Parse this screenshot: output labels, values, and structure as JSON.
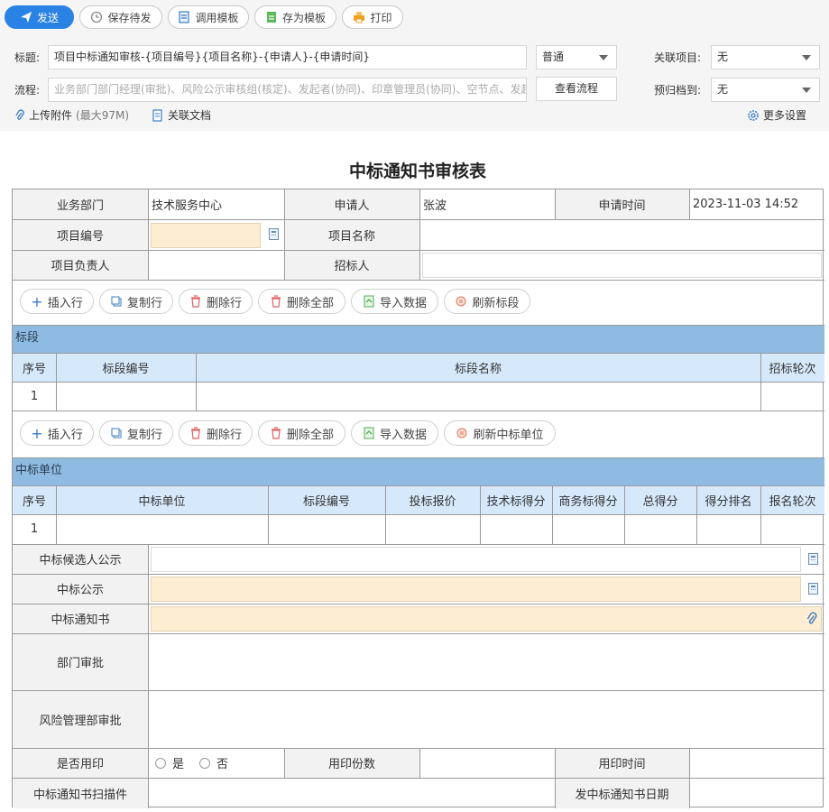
{
  "toolbar": {
    "send": "发送",
    "save_draft": "保存待发",
    "use_template": "调用模板",
    "save_template": "存为模板",
    "print": "打印"
  },
  "header": {
    "title_label": "标题:",
    "title_value": "项目中标通知审核-{项目编号}{项目名称}-{申请人}-{申请时间}",
    "priority_value": "普通",
    "related_project_label": "关联项目:",
    "related_project_value": "无",
    "flow_label": "流程:",
    "flow_placeholder": "业务部门部门经理(审批)、风险公示审核组(核定)、发起者(协同)、印章管理员(协同)、空节点、发起者",
    "view_flow": "查看流程",
    "archive_label": "预归档到:",
    "archive_value": "无",
    "upload": "上传附件",
    "upload_limit": "(最大97M)",
    "related_doc": "关联文档",
    "more_settings": "更多设置"
  },
  "form": {
    "title": "中标通知书审核表",
    "dept_label": "业务部门",
    "dept_value": "技术服务中心",
    "applicant_label": "申请人",
    "applicant_value": "张波",
    "apply_time_label": "申请时间",
    "apply_time_value": "2023-11-03 14:52",
    "project_no_label": "项目编号",
    "project_name_label": "项目名称",
    "project_lead_label": "项目负责人",
    "tenderer_label": "招标人",
    "sub_buttons_1": {
      "insert": "插入行",
      "copy": "复制行",
      "delete": "删除行",
      "delete_all": "删除全部",
      "import": "导入数据",
      "refresh": "刷新标段"
    },
    "section1": {
      "title": "标段",
      "columns": [
        "序号",
        "标段编号",
        "标段名称",
        "招标轮次"
      ],
      "rows": [
        [
          "1",
          "",
          "",
          ""
        ]
      ]
    },
    "sub_buttons_2": {
      "insert": "插入行",
      "copy": "复制行",
      "delete": "删除行",
      "delete_all": "删除全部",
      "import": "导入数据",
      "refresh": "刷新中标单位"
    },
    "section2": {
      "title": "中标单位",
      "columns": [
        "序号",
        "中标单位",
        "标段编号",
        "投标报价",
        "技术标得分",
        "商务标得分",
        "总得分",
        "得分排名",
        "报名轮次"
      ],
      "rows": [
        [
          "1",
          "",
          "",
          "",
          "",
          "",
          "",
          "",
          ""
        ]
      ]
    },
    "candidate_notice_label": "中标候选人公示",
    "award_notice_label": "中标公示",
    "award_letter_label": "中标通知书",
    "dept_approval_label": "部门审批",
    "risk_approval_label": "风险管理部审批",
    "use_seal_label": "是否用印",
    "yes": "是",
    "no": "否",
    "seal_copies_label": "用印份数",
    "seal_time_label": "用印时间",
    "scan_label": "中标通知书扫描件",
    "issue_date_label": "发中标通知书日期"
  },
  "colors": {
    "primary": "#2a82e4",
    "section_bar": "#8fbbe3",
    "column_header": "#d6e9fb",
    "required_field": "#fdeed3"
  }
}
